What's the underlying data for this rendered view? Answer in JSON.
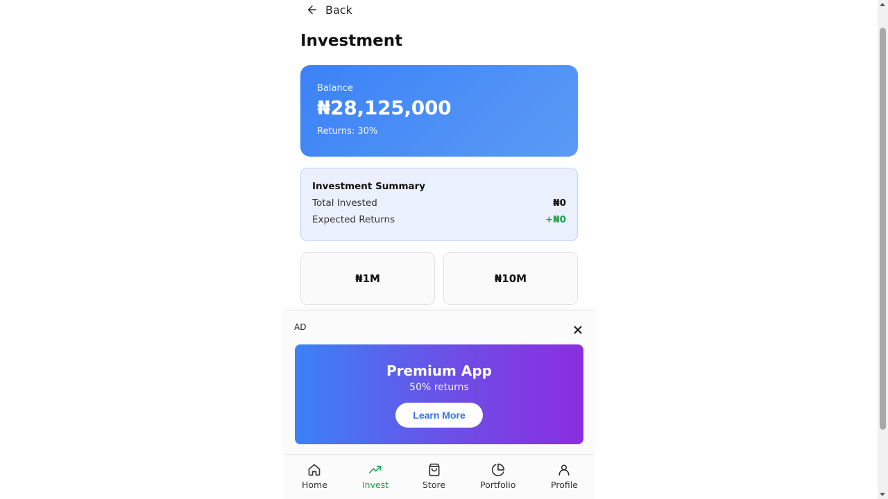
{
  "header": {
    "back_label": "Back",
    "title": "Investment"
  },
  "balance": {
    "label": "Balance",
    "amount": "₦28,125,000",
    "returns": "Returns: 30%"
  },
  "summary": {
    "title": "Investment Summary",
    "rows": [
      {
        "label": "Total Invested",
        "value": "₦0"
      },
      {
        "label": "Expected Returns",
        "value": "+₦0"
      }
    ]
  },
  "amounts": [
    "₦1M",
    "₦10M"
  ],
  "ad": {
    "label": "AD",
    "title": "Premium App",
    "subtitle": "50% returns",
    "cta": "Learn More"
  },
  "nav": {
    "items": [
      {
        "label": "Home",
        "icon": "home-icon",
        "active": false
      },
      {
        "label": "Invest",
        "icon": "trending-up-icon",
        "active": true
      },
      {
        "label": "Store",
        "icon": "shopping-bag-icon",
        "active": false
      },
      {
        "label": "Portfolio",
        "icon": "pie-chart-icon",
        "active": false
      },
      {
        "label": "Profile",
        "icon": "user-icon",
        "active": false
      }
    ]
  },
  "colors": {
    "accent_blue": "#3b82f6",
    "success_green": "#16a34a",
    "ad_gradient_end": "#8b2ddf"
  }
}
